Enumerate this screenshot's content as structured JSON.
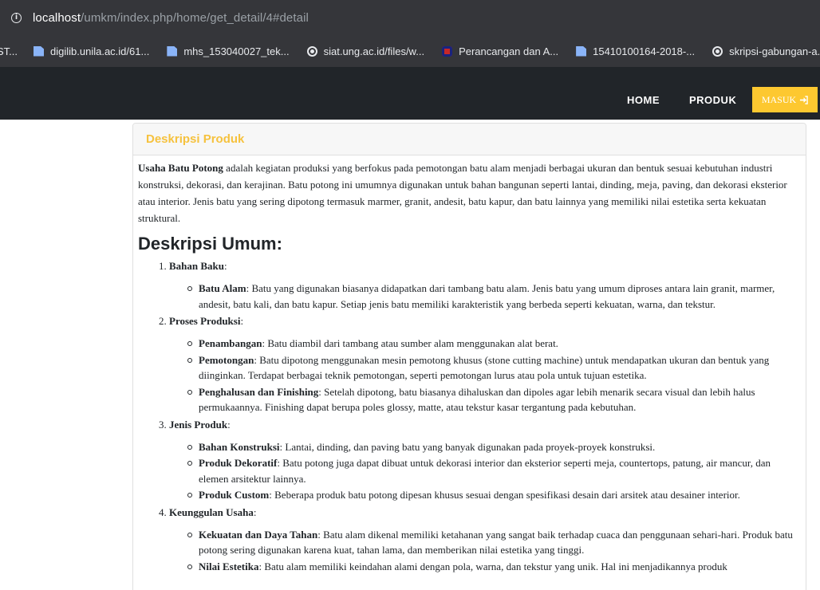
{
  "browser": {
    "url_host": "localhost",
    "url_path": "/umkm/index.php/home/get_detail/4#detail",
    "bookmarks": [
      {
        "label": "ST...",
        "icon": "none"
      },
      {
        "label": "digilib.unila.ac.id/61...",
        "icon": "file-icon"
      },
      {
        "label": "mhs_153040027_tek...",
        "icon": "file-icon"
      },
      {
        "label": "siat.ung.ac.id/files/w...",
        "icon": "globe-icon"
      },
      {
        "label": "Perancangan dan A...",
        "icon": "site-logo-icon"
      },
      {
        "label": "15410100164-2018-...",
        "icon": "file-icon"
      },
      {
        "label": "skripsi-gabungan-a...",
        "icon": "globe-icon"
      }
    ]
  },
  "navbar": {
    "home": "HOME",
    "produk": "PRODUK",
    "masuk": "MASUK",
    "masuk_icon": "login-arrow-icon",
    "accent": "#fdc830"
  },
  "card": {
    "header": "Deskripsi Produk",
    "intro_bold": "Usaha Batu Potong",
    "intro_text": " adalah kegiatan produksi yang berfokus pada pemotongan batu alam menjadi berbagai ukuran dan bentuk sesuai kebutuhan industri konstruksi, dekorasi, dan kerajinan. Batu potong ini umumnya digunakan untuk bahan bangunan seperti lantai, dinding, meja, paving, dan dekorasi eksterior atau interior. Jenis batu yang sering dipotong termasuk marmer, granit, andesit, batu kapur, dan batu lainnya yang memiliki nilai estetika serta kekuatan struktural.",
    "heading": "Deskripsi Umum:",
    "sections": [
      {
        "num": "1.",
        "title": "Bahan Baku",
        "items": [
          {
            "bold": "Batu Alam",
            "text": ": Batu yang digunakan biasanya didapatkan dari tambang batu alam. Jenis batu yang umum diproses antara lain granit, marmer, andesit, batu kali, dan batu kapur. Setiap jenis batu memiliki karakteristik yang berbeda seperti kekuatan, warna, dan tekstur."
          }
        ]
      },
      {
        "num": "2.",
        "title": "Proses Produksi",
        "items": [
          {
            "bold": "Penambangan",
            "text": ": Batu diambil dari tambang atau sumber alam menggunakan alat berat."
          },
          {
            "bold": "Pemotongan",
            "text": ": Batu dipotong menggunakan mesin pemotong khusus (stone cutting machine) untuk mendapatkan ukuran dan bentuk yang diinginkan. Terdapat berbagai teknik pemotongan, seperti pemotongan lurus atau pola untuk tujuan estetika."
          },
          {
            "bold": "Penghalusan dan Finishing",
            "text": ": Setelah dipotong, batu biasanya dihaluskan dan dipoles agar lebih menarik secara visual dan lebih halus permukaannya. Finishing dapat berupa poles glossy, matte, atau tekstur kasar tergantung pada kebutuhan."
          }
        ]
      },
      {
        "num": "3.",
        "title": "Jenis Produk",
        "items": [
          {
            "bold": "Bahan Konstruksi",
            "text": ": Lantai, dinding, dan paving batu yang banyak digunakan pada proyek-proyek konstruksi."
          },
          {
            "bold": "Produk Dekoratif",
            "text": ": Batu potong juga dapat dibuat untuk dekorasi interior dan eksterior seperti meja, countertops, patung, air mancur, dan elemen arsitektur lainnya."
          },
          {
            "bold": "Produk Custom",
            "text": ": Beberapa produk batu potong dipesan khusus sesuai dengan spesifikasi desain dari arsitek atau desainer interior."
          }
        ]
      },
      {
        "num": "4.",
        "title": "Keunggulan Usaha",
        "items": [
          {
            "bold": "Kekuatan dan Daya Tahan",
            "text": ": Batu alam dikenal memiliki ketahanan yang sangat baik terhadap cuaca dan penggunaan sehari-hari. Produk batu potong sering digunakan karena kuat, tahan lama, dan memberikan nilai estetika yang tinggi."
          },
          {
            "bold": "Nilai Estetika",
            "text": ": Batu alam memiliki keindahan alami dengan pola, warna, dan tekstur yang unik. Hal ini menjadikannya produk"
          }
        ]
      }
    ]
  }
}
